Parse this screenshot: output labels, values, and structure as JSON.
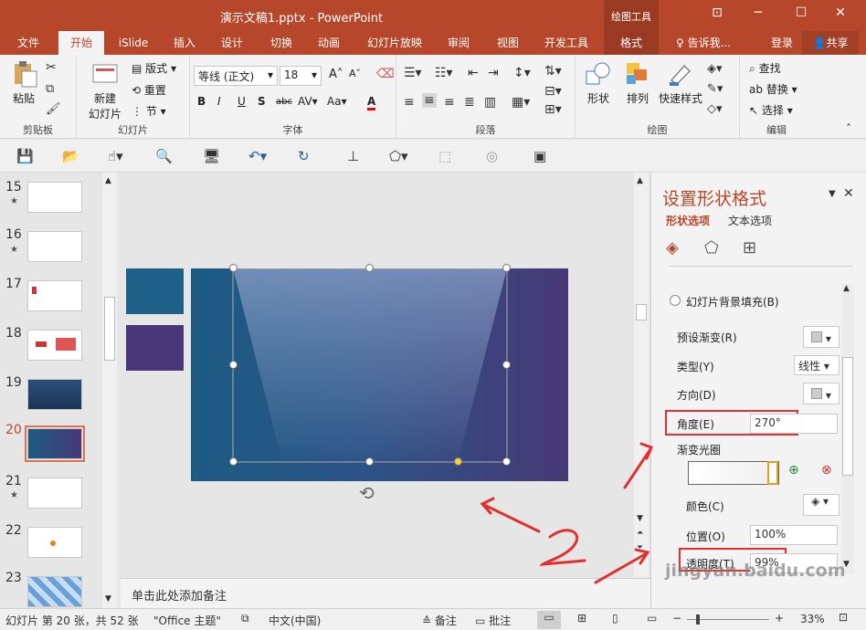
{
  "titlebar": {
    "title": "演示文稿1.pptx - PowerPoint",
    "context_label": "绘图工具"
  },
  "tabs": {
    "file": "文件",
    "home": "开始",
    "islide": "iSlide",
    "insert": "插入",
    "design": "设计",
    "transitions": "切换",
    "animations": "动画",
    "slideshow": "幻灯片放映",
    "review": "审阅",
    "view": "视图",
    "developer": "开发工具",
    "format": "格式",
    "tellme": "告诉我...",
    "login": "登录",
    "share": "共享"
  },
  "ribbon": {
    "clipboard": {
      "paste": "粘贴",
      "label": "剪贴板"
    },
    "slides": {
      "new_slide": "新建",
      "new_slide2": "幻灯片",
      "layout": "版式",
      "reset": "重置",
      "section": "节",
      "label": "幻灯片"
    },
    "font": {
      "name": "等线 (正文)",
      "size": "18",
      "bold": "B",
      "italic": "I",
      "underline": "U",
      "shadow": "S",
      "strike": "abc",
      "spacing": "AV",
      "case": "Aa",
      "color": "A",
      "grow": "A",
      "shrink": "A",
      "label": "字体"
    },
    "paragraph": {
      "label": "段落"
    },
    "drawing": {
      "shape": "形状",
      "arrange": "排列",
      "quickstyle": "快速样式",
      "label": "绘图"
    },
    "editing": {
      "find": "查找",
      "replace": "替换",
      "select": "选择",
      "label": "编辑"
    }
  },
  "thumbnails": [
    {
      "num": "15",
      "star": "★"
    },
    {
      "num": "16",
      "star": "★"
    },
    {
      "num": "17",
      "star": ""
    },
    {
      "num": "18",
      "star": ""
    },
    {
      "num": "19",
      "star": ""
    },
    {
      "num": "20",
      "star": ""
    },
    {
      "num": "21",
      "star": "★"
    },
    {
      "num": "22",
      "star": ""
    },
    {
      "num": "23",
      "star": ""
    }
  ],
  "notes": {
    "placeholder": "单击此处添加备注"
  },
  "pane": {
    "title": "设置形状格式",
    "tab_shape": "形状选项",
    "tab_text": "文本选项",
    "bg_fill": "幻灯片背景填充(B)",
    "preset": "预设渐变(R)",
    "type": "类型(Y)",
    "type_value": "线性",
    "direction": "方向(D)",
    "angle": "角度(E)",
    "angle_value": "270°",
    "stops": "渐变光圈",
    "color": "颜色(C)",
    "position": "位置(O)",
    "position_value": "100%",
    "transparency": "透明度(T)",
    "transparency_value": "99%"
  },
  "status": {
    "slide": "幻灯片 第 20 张，共 52 张",
    "theme": "\"Office 主题\"",
    "lang": "中文(中国)",
    "notes": "备注",
    "comments": "批注",
    "zoom": "33%"
  },
  "watermark": "jingyan.baidu.com",
  "colors": {
    "accent": "#b7472a",
    "annotation": "#e23030"
  }
}
